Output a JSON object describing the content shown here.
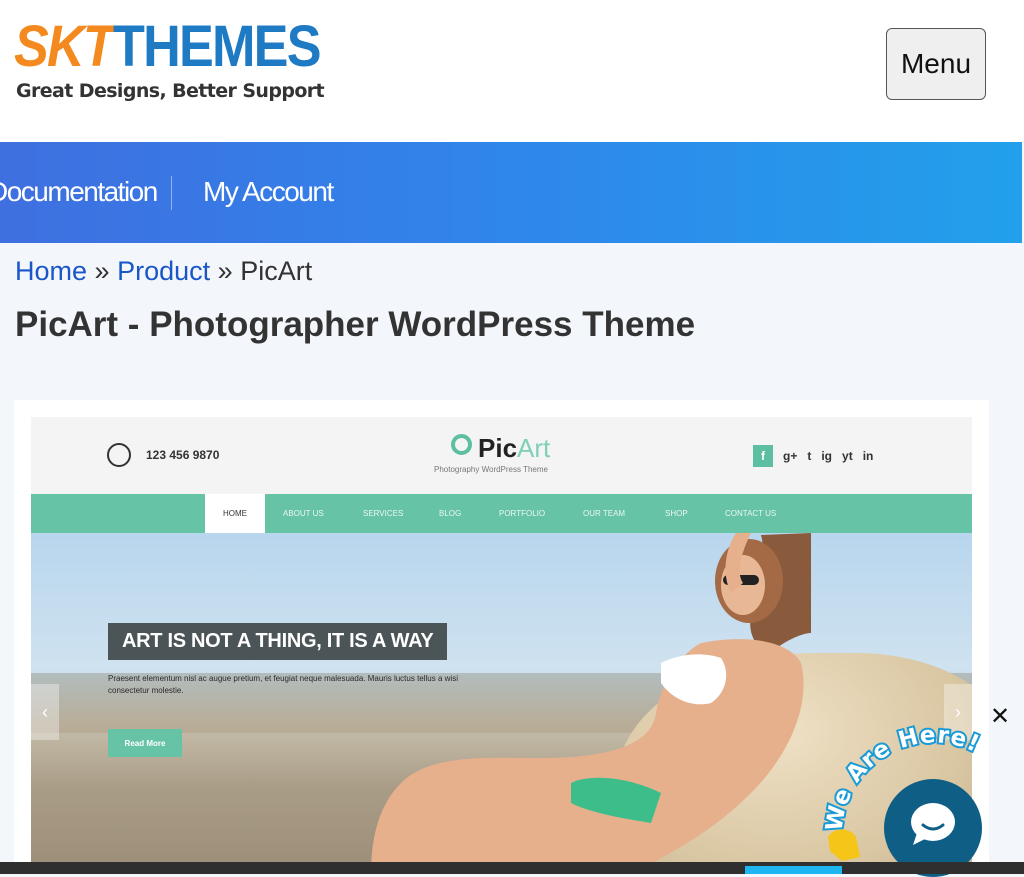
{
  "header": {
    "logo_main_part1": "SKT",
    "logo_main_part2": "THEMES",
    "logo_tagline": "Great Designs, Better Support",
    "menu_label": "Menu"
  },
  "nav": {
    "items": [
      {
        "label": "Documentation"
      },
      {
        "label": "My Account"
      }
    ]
  },
  "breadcrumb": {
    "home": "Home",
    "sep1": "»",
    "product": "Product",
    "sep2": "»",
    "current": "PicArt"
  },
  "page_title": "PicArt - Photographer WordPress Theme",
  "preview": {
    "phone": "123 456 9870",
    "logo_pic": "Pic",
    "logo_art": "Art",
    "logo_sub": "Photography WordPress Theme",
    "nav_items": [
      "HOME",
      "ABOUT US",
      "SERVICES",
      "BLOG",
      "PORTFOLIO",
      "OUR TEAM",
      "SHOP",
      "CONTACT US"
    ],
    "headline": "ART IS NOT A THING, IT IS A WAY",
    "body": "Praesent elementum nisl ac augue pretium, et feugiat neque malesuada. Mauris luctus tellus a wisi consectetur molestie.",
    "button": "Read More",
    "socials": [
      "f",
      "g+",
      "t",
      "ig",
      "yt",
      "in"
    ]
  },
  "chat": {
    "label": "We Are Here!",
    "close": "✕"
  },
  "colors": {
    "brand_orange": "#f48a1f",
    "brand_blue": "#1f7ac4",
    "nav_gradient_start": "#3f6fe0",
    "nav_gradient_end": "#22a0ea",
    "link_blue": "#1a56c8",
    "theme_teal": "#67c3a6",
    "chat_blue": "#0f5e86"
  }
}
